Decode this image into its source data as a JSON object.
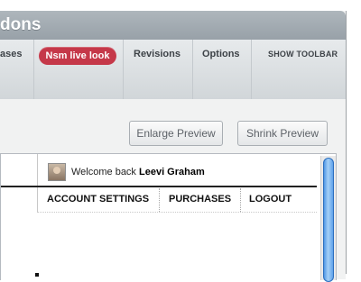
{
  "window": {
    "title": "dons"
  },
  "nav": {
    "items": [
      {
        "label": "ases"
      },
      {
        "label": "Nsm live look"
      },
      {
        "label": "Revisions"
      },
      {
        "label": "Options"
      },
      {
        "label": "SHOW TOOLBAR"
      }
    ]
  },
  "preview": {
    "enlarge_label": "Enlarge Preview",
    "shrink_label": "Shrink Preview"
  },
  "user": {
    "welcome_prefix": "Welcome back",
    "name": "Leevi Graham"
  },
  "account": {
    "links": [
      {
        "label": "ACCOUNT SETTINGS"
      },
      {
        "label": "PURCHASES"
      },
      {
        "label": "LOGOUT"
      }
    ]
  },
  "colors": {
    "accent_pill": "#c53849",
    "scroll_thumb": "#4f97e5",
    "titlebar": "#a4acb2"
  }
}
